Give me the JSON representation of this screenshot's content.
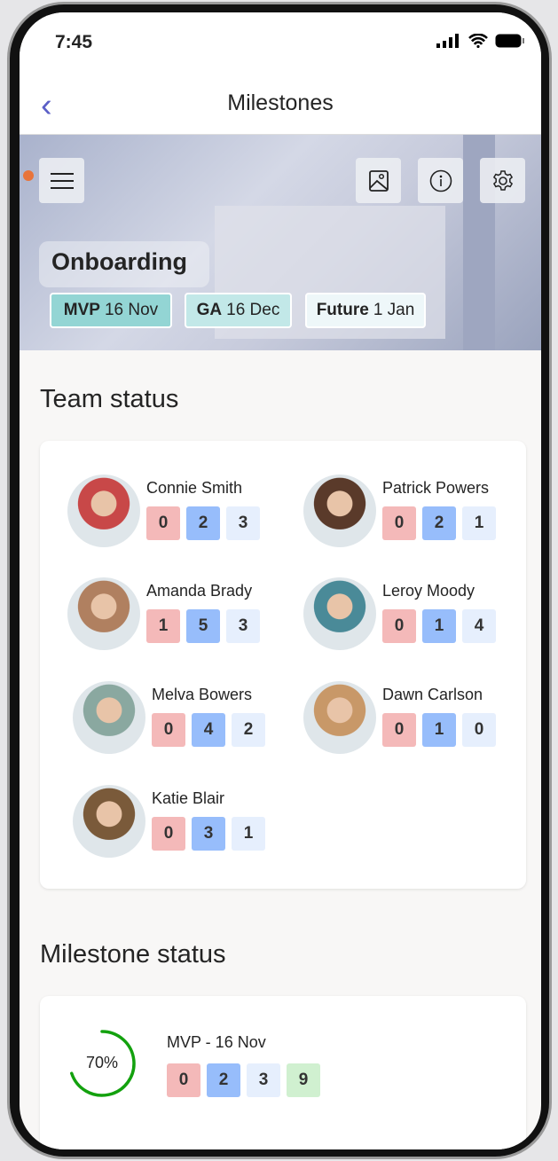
{
  "status_bar": {
    "time": "7:45"
  },
  "header": {
    "title": "Milestones",
    "back": "‹"
  },
  "banner": {
    "title": "Onboarding",
    "chips": [
      {
        "label": "MVP",
        "date": "16 Nov",
        "color": "#93d5d4"
      },
      {
        "label": "GA",
        "date": "16 Dec",
        "color": "#c2e8e8"
      },
      {
        "label": "Future",
        "date": "1 Jan",
        "color": "#eef7f9"
      }
    ]
  },
  "team_status": {
    "heading": "Team status",
    "members": [
      {
        "name": "Connie Smith",
        "counts": [
          0,
          2,
          3
        ],
        "tone": "#c84848"
      },
      {
        "name": "Patrick Powers",
        "counts": [
          0,
          2,
          1
        ],
        "tone": "#5a3a2a"
      },
      {
        "name": "Amanda Brady",
        "counts": [
          1,
          5,
          3
        ],
        "tone": "#b08060"
      },
      {
        "name": "Leroy Moody",
        "counts": [
          0,
          1,
          4
        ],
        "tone": "#4a8a98"
      },
      {
        "name": "Melva Bowers",
        "counts": [
          0,
          4,
          2
        ],
        "tone": "#8aa8a0"
      },
      {
        "name": "Dawn Carlson",
        "counts": [
          0,
          1,
          0
        ],
        "tone": "#c89868"
      },
      {
        "name": "Katie Blair",
        "counts": [
          0,
          3,
          1
        ],
        "tone": "#7a5a3a"
      }
    ]
  },
  "milestone_status": {
    "heading": "Milestone status",
    "items": [
      {
        "name": "MVP - 16 Nov",
        "progress_percent": 70,
        "progress_label": "70%",
        "counts": [
          0,
          2,
          3,
          9
        ],
        "ring_color": "#13a10e"
      }
    ]
  }
}
